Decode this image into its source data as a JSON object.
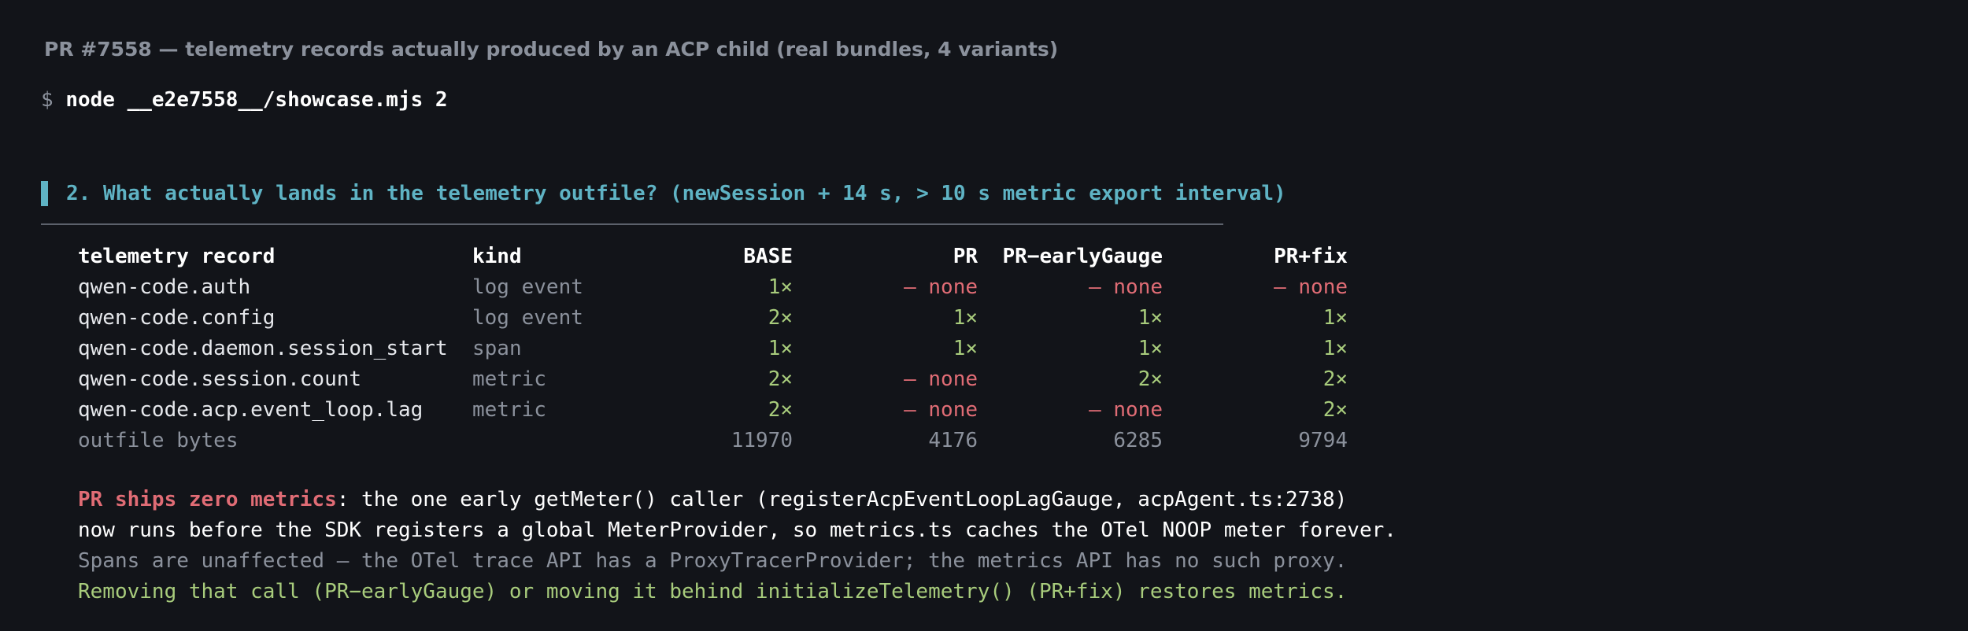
{
  "header": {
    "title": "PR #7558 — telemetry records actually produced by an ACP child (real bundles, 4 variants)"
  },
  "terminal": {
    "prompt": "$",
    "command": "node __e2e7558__/showcase.mjs 2"
  },
  "section": {
    "title": "2. What actually lands in the telemetry outfile? (newSession + 14 s, > 10 s metric export interval)"
  },
  "table": {
    "headers": [
      "telemetry record",
      "kind",
      "BASE",
      "PR",
      "PR−earlyGauge",
      "PR+fix"
    ],
    "rows": [
      {
        "record": "qwen-code.auth",
        "kind": "log event",
        "base": "1×",
        "pr": "– none",
        "early": "– none",
        "fix": "– none"
      },
      {
        "record": "qwen-code.config",
        "kind": "log event",
        "base": "2×",
        "pr": "1×",
        "early": "1×",
        "fix": "1×"
      },
      {
        "record": "qwen-code.daemon.session_start",
        "kind": "span",
        "base": "1×",
        "pr": "1×",
        "early": "1×",
        "fix": "1×"
      },
      {
        "record": "qwen-code.session.count",
        "kind": "metric",
        "base": "2×",
        "pr": "– none",
        "early": "2×",
        "fix": "2×"
      },
      {
        "record": "qwen-code.acp.event_loop.lag",
        "kind": "metric",
        "base": "2×",
        "pr": "– none",
        "early": "– none",
        "fix": "2×"
      }
    ],
    "footer": {
      "label": "outfile bytes",
      "base": "11970",
      "pr": "4176",
      "early": "6285",
      "fix": "9794"
    }
  },
  "notes": {
    "highlight": "PR ships zero metrics",
    "line1_rest": ": the one early getMeter() caller (registerAcpEventLoopLagGauge, acpAgent.ts:2738)",
    "line2": "now runs before the SDK registers a global MeterProvider, so metrics.ts caches the OTel NOOP meter forever.",
    "line3": "Spans are unaffected — the OTel trace API has a ProxyTracerProvider; the metrics API has no such proxy.",
    "line4": "Removing that call (PR−earlyGauge) or moving it behind initializeTelemetry() (PR+fix) restores metrics."
  },
  "colors": {
    "background": "#121419",
    "accent": "#5fb3c4",
    "ok": "#a8cc7c",
    "none": "#e06c75",
    "dim": "#8b919c"
  }
}
